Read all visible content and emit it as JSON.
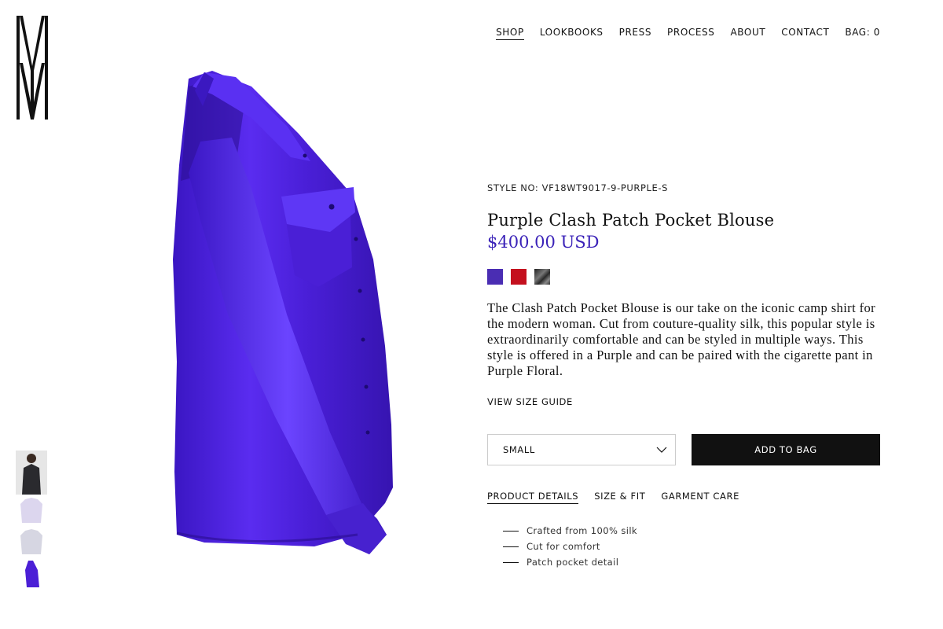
{
  "nav": {
    "items": [
      {
        "label": "SHOP",
        "active": true
      },
      {
        "label": "LOOKBOOKS"
      },
      {
        "label": "PRESS"
      },
      {
        "label": "PROCESS"
      },
      {
        "label": "ABOUT"
      },
      {
        "label": "CONTACT"
      },
      {
        "label": "BAG: 0"
      }
    ]
  },
  "product": {
    "style_no": "STYLE NO: VF18WT9017-9-PURPLE-S",
    "title": "Purple Clash Patch Pocket Blouse",
    "price": "$400.00 USD",
    "swatches": [
      {
        "name": "purple",
        "color": "#4a2db3"
      },
      {
        "name": "red",
        "color": "#c4101e"
      },
      {
        "name": "black-metallic",
        "color": "#3c3c3c"
      }
    ],
    "description": "The Clash Patch Pocket Blouse is our take on the iconic camp shirt for the modern woman. Cut from couture-quality silk, this popular style is extraordinarily comfortable and can be styled in multiple ways. This style is offered in a Purple and can be paired with the cigarette pant in Purple Floral.",
    "size_guide": "VIEW SIZE GUIDE",
    "size_selected": "SMALL",
    "add_to_bag": "ADD TO BAG",
    "tabs": [
      {
        "label": "PRODUCT DETAILS",
        "active": true
      },
      {
        "label": "SIZE & FIT"
      },
      {
        "label": "GARMENT CARE"
      }
    ],
    "features": [
      "Crafted from 100% silk",
      "Cut for comfort",
      "Patch pocket detail"
    ]
  },
  "colors": {
    "blouse": "#4b1fd6",
    "blouse_dark": "#2e0f9e",
    "blouse_light": "#7a55ff",
    "text": "#111111"
  }
}
